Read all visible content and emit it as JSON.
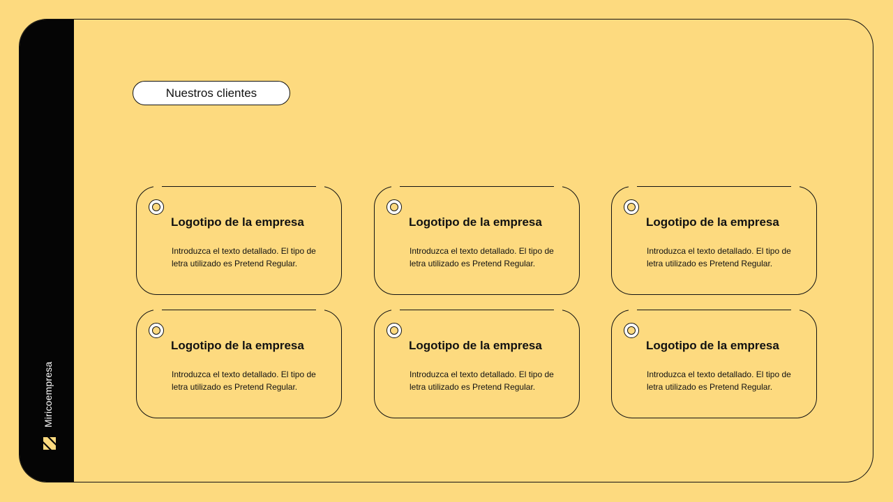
{
  "brand": {
    "name": "Miricoempresa",
    "icon": "brand-logo-icon"
  },
  "header": {
    "pill_label": "Nuestros clientes"
  },
  "cards": [
    {
      "title": "Logotipo de la empresa",
      "text": "Introduzca el texto detallado. El tipo de letra utilizado es Pretend Regular."
    },
    {
      "title": "Logotipo de la empresa",
      "text": "Introduzca el texto detallado. El tipo de letra utilizado es Pretend Regular."
    },
    {
      "title": "Logotipo de la empresa",
      "text": "Introduzca el texto detallado. El tipo de letra utilizado es Pretend Regular."
    },
    {
      "title": "Logotipo de la empresa",
      "text": "Introduzca el texto detallado. El tipo de letra utilizado es Pretend Regular."
    },
    {
      "title": "Logotipo de la empresa",
      "text": "Introduzca el texto detallado. El tipo de letra utilizado es Pretend Regular."
    },
    {
      "title": "Logotipo de la empresa",
      "text": "Introduzca el texto detallado. El tipo de letra utilizado es Pretend Regular."
    }
  ],
  "colors": {
    "background": "#FDDA7F",
    "sidebar": "#050505",
    "accent": "#FDDA7F"
  }
}
